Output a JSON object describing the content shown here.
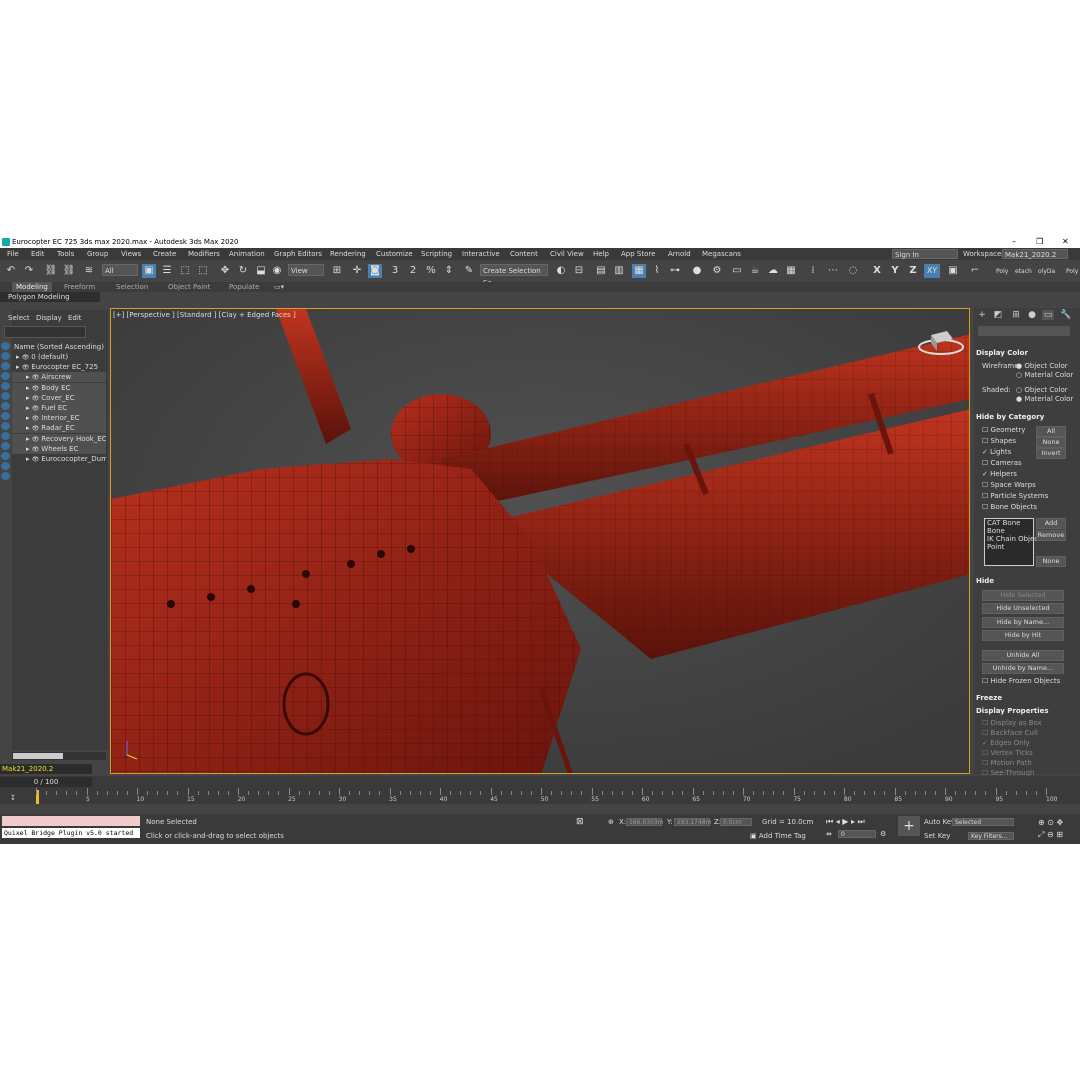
{
  "window": {
    "title": "Eurocopter EC 725 3ds max 2020.max - Autodesk 3ds Max 2020",
    "minimize": "–",
    "maximize": "❐",
    "close": "✕"
  },
  "menu": [
    "File",
    "Edit",
    "Tools",
    "Group",
    "Views",
    "Create",
    "Modifiers",
    "Animation",
    "Graph Editors",
    "Rendering",
    "Customize",
    "Scripting",
    "Interactive",
    "Content",
    "Civil View",
    "Help",
    "App Store",
    "Arnold",
    "Megascans"
  ],
  "account": {
    "sign_in": "Sign In",
    "workspaces_label": "Workspaces:",
    "workspace": "Mak21_2020.2"
  },
  "toolbar": {
    "filter": "All",
    "ref_coord": "View",
    "selection_set": "Create Selection Se",
    "axes": [
      "X",
      "Y",
      "Z",
      "XY"
    ],
    "snap_labels": [
      "3",
      "2",
      "%"
    ],
    "ribbon_tail": [
      "Poly",
      "etach",
      "olyDa",
      "Poly"
    ]
  },
  "ribbon": {
    "tabs": [
      "Modeling",
      "Freeform",
      "Selection",
      "Object Paint",
      "Populate"
    ],
    "panel": "Polygon Modeling"
  },
  "scene_explorer": {
    "menu": [
      "Select",
      "Display",
      "Edit"
    ],
    "header": "Name (Sorted Ascending)",
    "rows": [
      {
        "label": "0 (default)",
        "indent": 1,
        "hl": false
      },
      {
        "label": "Eurocopter EC_725",
        "indent": 1,
        "hl": false
      },
      {
        "label": "Airscrew",
        "indent": 2,
        "hl": true
      },
      {
        "label": "Body EC",
        "indent": 2,
        "hl": true
      },
      {
        "label": "Cover_EC",
        "indent": 2,
        "hl": true
      },
      {
        "label": "Fuel EC",
        "indent": 2,
        "hl": true
      },
      {
        "label": "Interior_EC",
        "indent": 2,
        "hl": true
      },
      {
        "label": "Radar_EC",
        "indent": 2,
        "hl": true
      },
      {
        "label": "Recovery Hook_EC",
        "indent": 2,
        "hl": true
      },
      {
        "label": "Wheels EC",
        "indent": 2,
        "hl": true
      },
      {
        "label": "Eurococopter_Dum",
        "indent": 2,
        "hl": false
      }
    ],
    "layer": "Mak21_2020.2"
  },
  "viewport": {
    "label": "[+] [Perspective ] [Standard ] [Clay + Edged Faces ]"
  },
  "command_panel": {
    "display_color": {
      "title": "Display Color",
      "wireframe": "Wireframe:",
      "shaded": "Shaded:",
      "object_color": "Object Color",
      "material_color": "Material Color"
    },
    "hide_by_category": {
      "title": "Hide by Category",
      "items": [
        {
          "label": "Geometry",
          "checked": false
        },
        {
          "label": "Shapes",
          "checked": false
        },
        {
          "label": "Lights",
          "checked": true
        },
        {
          "label": "Cameras",
          "checked": false
        },
        {
          "label": "Helpers",
          "checked": true
        },
        {
          "label": "Space Warps",
          "checked": false
        },
        {
          "label": "Particle Systems",
          "checked": false
        },
        {
          "label": "Bone Objects",
          "checked": false
        }
      ],
      "buttons": [
        "All",
        "None",
        "Invert"
      ],
      "list": [
        "CAT Bone",
        "Bone",
        "IK Chain Object",
        "Point"
      ],
      "list_buttons": [
        "Add",
        "Remove",
        "None"
      ]
    },
    "hide": {
      "title": "Hide",
      "buttons": [
        "Hide Selected",
        "Hide Unselected",
        "Hide by Name...",
        "Hide by Hit",
        "Unhide All",
        "Unhide by Name..."
      ],
      "hide_frozen": "Hide Frozen Objects"
    },
    "freeze": {
      "title": "Freeze"
    },
    "display_properties": {
      "title": "Display Properties",
      "items": [
        "Display as Box",
        "Backface Cull",
        "Edges Only",
        "Vertex Ticks",
        "Motion Path",
        "See-Through"
      ]
    }
  },
  "timeline": {
    "slider": "0 / 100",
    "ticks": [
      "5",
      "10",
      "15",
      "20",
      "25",
      "30",
      "35",
      "40",
      "45",
      "50",
      "55",
      "60",
      "65",
      "70",
      "75",
      "80",
      "85",
      "90",
      "95",
      "100"
    ]
  },
  "status": {
    "maxscript": "Quixel Bridge Plugin v5.0 started",
    "selection": "None Selected",
    "prompt": "Click or click-and-drag to select objects",
    "x_label": "X:",
    "x_value": "166.6303m",
    "y_label": "Y:",
    "y_value": "283.1748m",
    "z_label": "Z:",
    "z_value": "0.0cm",
    "grid": "Grid = 10.0cm",
    "add_time_tag": "Add Time Tag",
    "frame": "0",
    "auto_key": "Auto Key",
    "set_key": "Set Key",
    "key_mode": "Selected",
    "key_filters": "Key Filters..."
  },
  "colors": {
    "viewport_border": "#d8a020",
    "accent": "#4a7fb0",
    "mesh": "#a8281c"
  }
}
